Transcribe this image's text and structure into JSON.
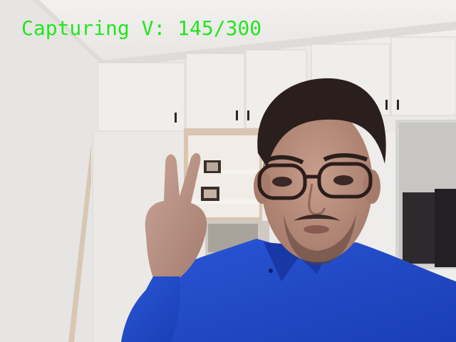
{
  "capture": {
    "status_text": "Capturing V: 145/300",
    "gesture_label": "V",
    "captured_count": 145,
    "total_count": 300,
    "progress_fraction": 0.4833
  },
  "colors": {
    "overlay_text": "#22e61e",
    "wall": "#e9e8e6",
    "cabinet": "#eceae6",
    "shirt": "#1f47c9",
    "skin": "#b78d7c",
    "hair": "#2a1f1c"
  }
}
